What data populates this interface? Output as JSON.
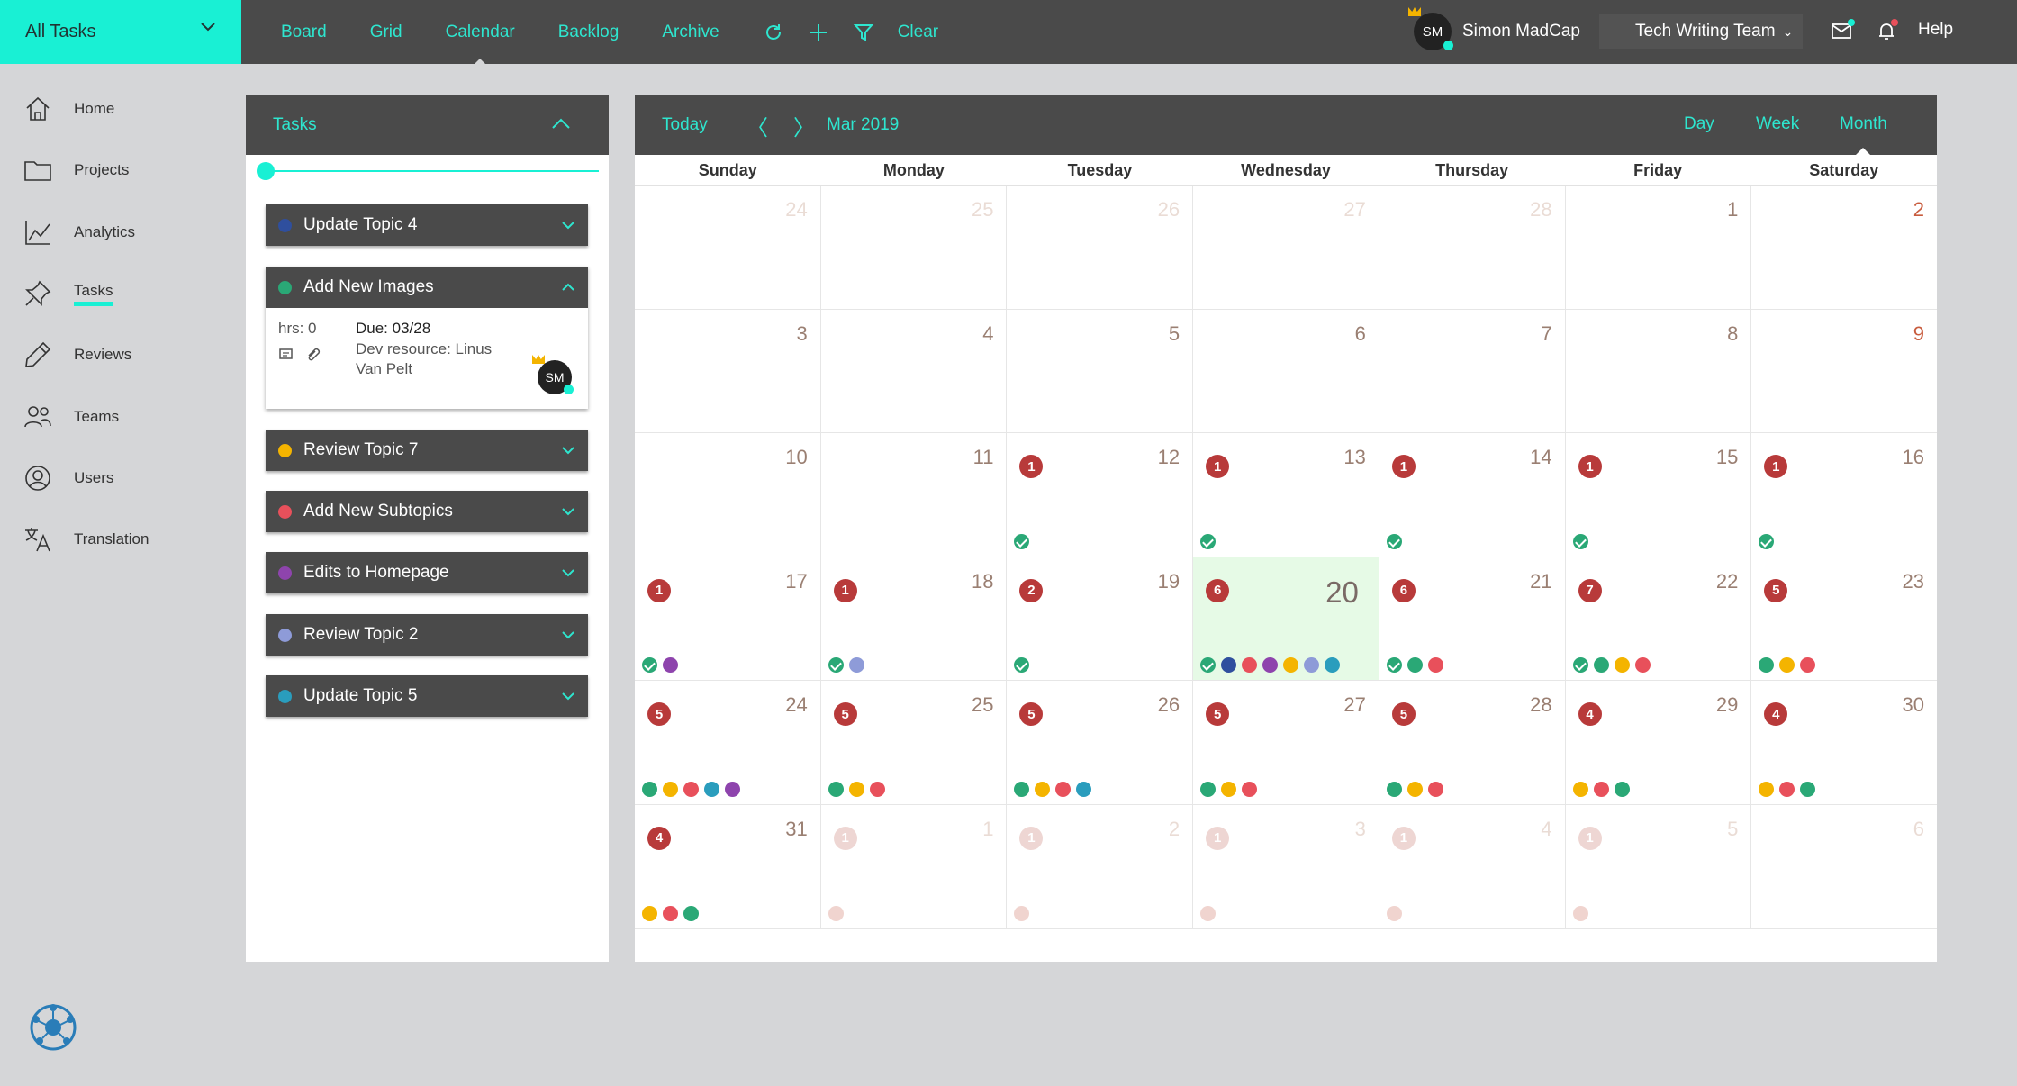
{
  "topbar": {
    "workspace": "All Tasks",
    "nav": [
      {
        "label": "Board"
      },
      {
        "label": "Grid"
      },
      {
        "label": "Calendar",
        "active": true
      },
      {
        "label": "Backlog"
      },
      {
        "label": "Archive"
      }
    ],
    "clear_label": "Clear",
    "user_initials": "SM",
    "user_name": "Simon MadCap",
    "team": "Tech Writing Team",
    "help": "Help"
  },
  "sidebar": {
    "items": [
      {
        "label": "Home",
        "icon": "home-icon"
      },
      {
        "label": "Projects",
        "icon": "folder-icon"
      },
      {
        "label": "Analytics",
        "icon": "analytics-icon"
      },
      {
        "label": "Tasks",
        "icon": "pin-icon",
        "active": true
      },
      {
        "label": "Reviews",
        "icon": "pencil-icon"
      },
      {
        "label": "Teams",
        "icon": "teams-icon"
      },
      {
        "label": "Users",
        "icon": "user-icon"
      },
      {
        "label": "Translation",
        "icon": "translate-icon"
      }
    ]
  },
  "tasks_panel": {
    "title": "Tasks",
    "tasks": [
      {
        "label": "Update Topic 4",
        "color": "#2f4f9e"
      },
      {
        "label": "Add New Images",
        "color": "#2aa876",
        "expanded": true
      },
      {
        "label": "Review Topic 7",
        "color": "#f4b400"
      },
      {
        "label": "Add New Subtopics",
        "color": "#e8505b"
      },
      {
        "label": "Edits to Homepage",
        "color": "#8e44ad"
      },
      {
        "label": "Review Topic 2",
        "color": "#8e9bd8"
      },
      {
        "label": "Update Topic 5",
        "color": "#2a9dbd"
      }
    ],
    "detail": {
      "hrs": "hrs: 0",
      "due": "Due: 03/28",
      "resource_line1": "Dev resource: Linus",
      "resource_line2": "Van Pelt",
      "assignee": "SM"
    }
  },
  "calendar": {
    "today_label": "Today",
    "month": "Mar 2019",
    "views": [
      "Day",
      "Week",
      "Month"
    ],
    "active_view": "Month",
    "weekdays": [
      "Sunday",
      "Monday",
      "Tuesday",
      "Wednesday",
      "Thursday",
      "Friday",
      "Saturday"
    ],
    "colors": {
      "G": "#2aa876",
      "B": "#2f4f9e",
      "R": "#e8505b",
      "Y": "#f4b400",
      "P": "#8e44ad",
      "L": "#8e9bd8",
      "T": "#2a9dbd",
      "F": "#f0d4cf"
    },
    "weeks": [
      [
        {
          "d": "24",
          "f": 1
        },
        {
          "d": "25",
          "f": 1
        },
        {
          "d": "26",
          "f": 1
        },
        {
          "d": "27",
          "f": 1
        },
        {
          "d": "28",
          "f": 1
        },
        {
          "d": "1"
        },
        {
          "d": "2",
          "red": 1
        }
      ],
      [
        {
          "d": "3"
        },
        {
          "d": "4"
        },
        {
          "d": "5"
        },
        {
          "d": "6"
        },
        {
          "d": "7"
        },
        {
          "d": "8"
        },
        {
          "d": "9",
          "red": 1
        }
      ],
      [
        {
          "d": "10"
        },
        {
          "d": "11"
        },
        {
          "d": "12",
          "b": "1",
          "c": 1
        },
        {
          "d": "13",
          "b": "1",
          "c": 1
        },
        {
          "d": "14",
          "b": "1",
          "c": 1
        },
        {
          "d": "15",
          "b": "1",
          "c": 1
        },
        {
          "d": "16",
          "b": "1",
          "c": 1
        }
      ],
      [
        {
          "d": "17",
          "b": "1",
          "c": 1,
          "dots": "P"
        },
        {
          "d": "18",
          "b": "1",
          "c": 1,
          "dots": "L"
        },
        {
          "d": "19",
          "b": "2",
          "c": 1
        },
        {
          "d": "20",
          "b": "6",
          "c": 1,
          "dots": "BRPYLT",
          "hl": 1
        },
        {
          "d": "21",
          "b": "6",
          "c": 1,
          "dots": "GR"
        },
        {
          "d": "22",
          "b": "7",
          "c": 1,
          "dots": "GYR"
        },
        {
          "d": "23",
          "b": "5",
          "dots": "GYR"
        }
      ],
      [
        {
          "d": "24",
          "b": "5",
          "dots": "GYRTP"
        },
        {
          "d": "25",
          "b": "5",
          "dots": "GYR"
        },
        {
          "d": "26",
          "b": "5",
          "dots": "GYRT"
        },
        {
          "d": "27",
          "b": "5",
          "dots": "GYR"
        },
        {
          "d": "28",
          "b": "5",
          "dots": "GYR"
        },
        {
          "d": "29",
          "b": "4",
          "dots": "YRG"
        },
        {
          "d": "30",
          "b": "4",
          "dots": "YRG"
        }
      ],
      [
        {
          "d": "31",
          "b": "4",
          "dots": "YRG"
        },
        {
          "d": "1",
          "f": 1,
          "b": "1",
          "bf": 1,
          "dots": "F"
        },
        {
          "d": "2",
          "f": 1,
          "b": "1",
          "bf": 1,
          "dots": "F"
        },
        {
          "d": "3",
          "f": 1,
          "b": "1",
          "bf": 1,
          "dots": "F"
        },
        {
          "d": "4",
          "f": 1,
          "b": "1",
          "bf": 1,
          "dots": "F"
        },
        {
          "d": "5",
          "f": 1,
          "b": "1",
          "bf": 1,
          "dots": "F"
        },
        {
          "d": "6",
          "f": 1
        }
      ]
    ]
  }
}
